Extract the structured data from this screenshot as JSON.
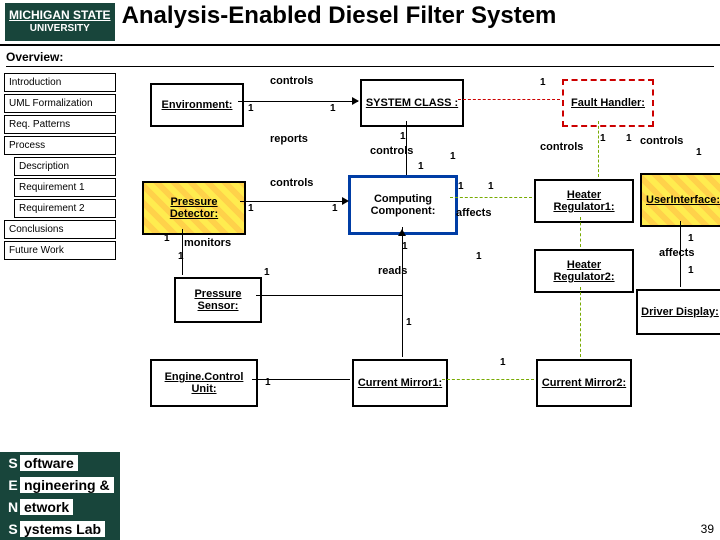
{
  "header": {
    "logo_top": "MICHIGAN STATE",
    "logo_bottom": "UNIVERSITY",
    "title": "Analysis-Enabled Diesel Filter System"
  },
  "overview_label": "Overview:",
  "nav": {
    "introduction": "Introduction",
    "uml": "UML Formalization",
    "patterns": "Req. Patterns",
    "process": "Process",
    "description": "Description",
    "req1": "Requirement 1",
    "req2": "Requirement 2",
    "conclusions": "Conclusions",
    "future": "Future Work"
  },
  "boxes": {
    "environment": "Environment:",
    "system_class": "SYSTEM CLASS  :",
    "fault_handler": "Fault Handler:",
    "computing_component": "Computing Component:",
    "pressure_detector": "Pressure Detector:",
    "heater_reg1": "Heater Regulator1:",
    "heater_reg2": "Heater Regulator2:",
    "user_interface": "UserInterface:",
    "pressure_sensor": "Pressure Sensor:",
    "driver_display": "Driver Display:",
    "engine_control_unit": "Engine.Control Unit:",
    "current_mirror1": "Current Mirror1:",
    "current_mirror2": "Current Mirror2:"
  },
  "edges": {
    "controls": "controls",
    "reports": "reports",
    "monitors": "monitors",
    "reads": "reads",
    "affects": "affects"
  },
  "mults": {
    "one": "1"
  },
  "footer": {
    "s": "S",
    "s_rest": "oftware",
    "e": "E",
    "e_rest": "ngineering &",
    "n": "N",
    "n_rest": "etwork",
    "y": "S",
    "y_rest": "ystems Lab"
  },
  "page_number": "39"
}
